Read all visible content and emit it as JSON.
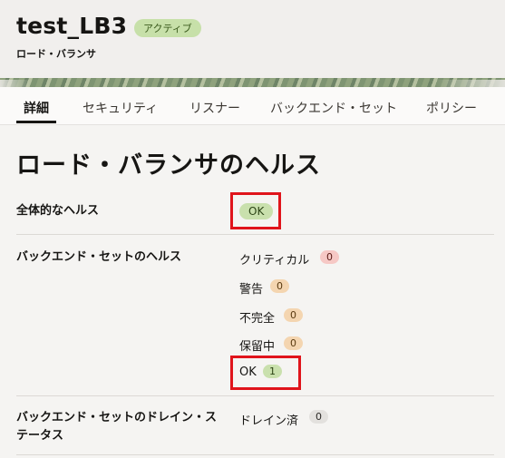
{
  "header": {
    "title": "test_LB3",
    "status_badge": "アクティブ",
    "subtitle": "ロード・バランサ"
  },
  "tabs": [
    {
      "label": "詳細",
      "active": true
    },
    {
      "label": "セキュリティ",
      "active": false
    },
    {
      "label": "リスナー",
      "active": false
    },
    {
      "label": "バックエンド・セット",
      "active": false
    },
    {
      "label": "ポリシー",
      "active": false
    }
  ],
  "health": {
    "section_title": "ロード・バランサのヘルス",
    "overall": {
      "label": "全体的なヘルス",
      "value": "OK"
    },
    "backend_sets": {
      "label": "バックエンド・セットのヘルス",
      "items": [
        {
          "label": "クリティカル",
          "count": "0"
        },
        {
          "label": "警告",
          "count": "0"
        },
        {
          "label": "不完全",
          "count": "0"
        },
        {
          "label": "保留中",
          "count": "0"
        },
        {
          "label": "OK",
          "count": "1"
        }
      ]
    },
    "drain": {
      "label_line1": "バックエンド・セットのドレイン・ス",
      "label_line2": "テータス",
      "item_label": "ドレイン済",
      "count": "0"
    }
  },
  "colors": {
    "highlight": "#e0141b",
    "ok_badge": "#c9e0ad",
    "critical_badge": "#f6c8c5",
    "warning_badge": "#f4d5b0"
  }
}
